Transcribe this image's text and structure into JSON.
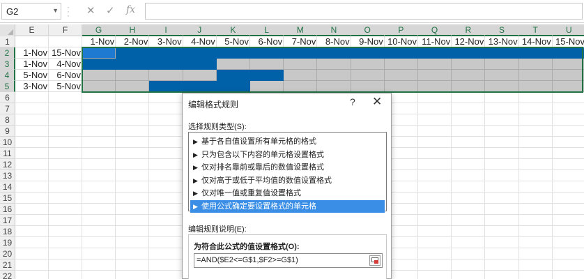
{
  "name_box": {
    "value": "G2",
    "dropdown_icon": "chevron-down-icon"
  },
  "formula_bar": {
    "cancel_icon": "close-icon",
    "enter_icon": "check-icon",
    "fx_label": "fx",
    "value": ""
  },
  "columns": [
    "E",
    "F",
    "G",
    "H",
    "I",
    "J",
    "K",
    "L",
    "M",
    "N",
    "O",
    "P",
    "Q",
    "R",
    "S",
    "T",
    "U"
  ],
  "rows": [
    "1",
    "2",
    "3",
    "4",
    "5",
    "6",
    "7",
    "8",
    "9",
    "10",
    "11",
    "12",
    "13",
    "14",
    "15",
    "16",
    "17",
    "18",
    "19",
    "20",
    "21",
    "22"
  ],
  "date_headers": [
    "1-Nov",
    "2-Nov",
    "3-Nov",
    "4-Nov",
    "5-Nov",
    "6-Nov",
    "7-Nov",
    "8-Nov",
    "9-Nov",
    "10-Nov",
    "11-Nov",
    "12-Nov",
    "13-Nov",
    "14-Nov",
    "15-Nov"
  ],
  "tasks": [
    {
      "start": "1-Nov",
      "end": "15-Nov"
    },
    {
      "start": "1-Nov",
      "end": "4-Nov"
    },
    {
      "start": "5-Nov",
      "end": "6-Nov"
    },
    {
      "start": "3-Nov",
      "end": "5-Nov"
    }
  ],
  "gantt": [
    [
      1,
      1,
      1,
      1,
      1,
      1,
      1,
      1,
      1,
      1,
      1,
      1,
      1,
      1,
      1
    ],
    [
      1,
      1,
      1,
      1,
      0,
      0,
      0,
      0,
      0,
      0,
      0,
      0,
      0,
      0,
      0
    ],
    [
      0,
      0,
      0,
      0,
      1,
      1,
      0,
      0,
      0,
      0,
      0,
      0,
      0,
      0,
      0
    ],
    [
      0,
      0,
      1,
      1,
      1,
      0,
      0,
      0,
      0,
      0,
      0,
      0,
      0,
      0,
      0
    ]
  ],
  "colors": {
    "bar_fill": "#0060a8",
    "empty_fill": "#c8c8c8",
    "selection": "#217346",
    "list_highlight": "#3a8ee6"
  },
  "dialog": {
    "title": "编辑格式规则",
    "help_icon": "?",
    "close_icon": "✕",
    "rule_type_label": "选择规则类型(S):",
    "rule_types": [
      "基于各自值设置所有单元格的格式",
      "只为包含以下内容的单元格设置格式",
      "仅对排名靠前或靠后的数值设置格式",
      "仅对高于或低于平均值的数值设置格式",
      "仅对唯一值或重复值设置格式",
      "使用公式确定要设置格式的单元格"
    ],
    "selected_rule_index": 5,
    "description_label": "编辑规则说明(E):",
    "formula_heading": "为符合此公式的值设置格式(O):",
    "formula": "=AND($E2<=G$1,$F2>=G$1)"
  }
}
